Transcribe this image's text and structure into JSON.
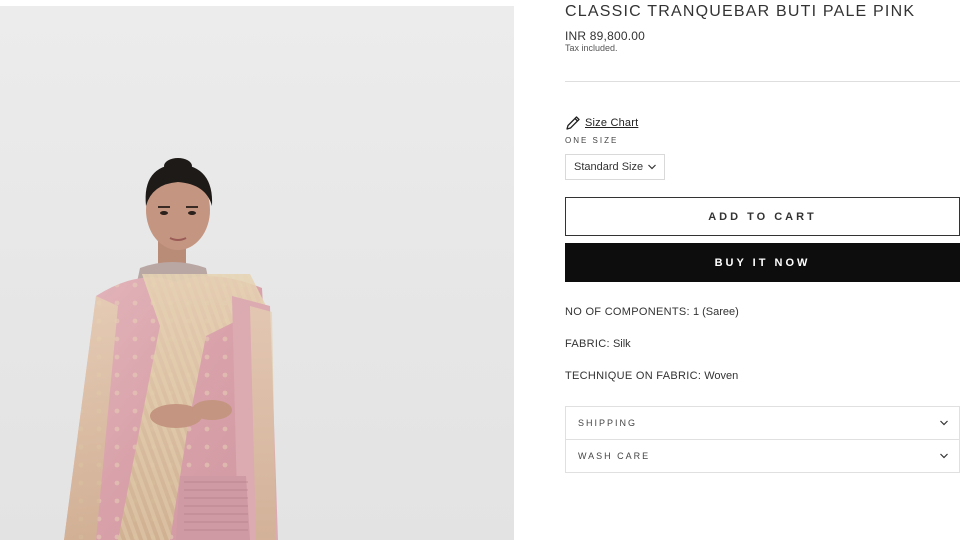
{
  "product": {
    "title": "CLASSIC TRANQUEBAR BUTI PALE PINK",
    "price": "INR 89,800.00",
    "tax_note": "Tax included.",
    "image_alt": "Model wearing pale pink silk saree"
  },
  "size": {
    "chart_link": "Size Chart",
    "label": "ONE SIZE",
    "selected": "Standard Size"
  },
  "actions": {
    "add_to_cart": "ADD TO CART",
    "buy_now": "BUY IT NOW"
  },
  "specs": [
    {
      "key": "NO OF COMPONENTS:",
      "value": "1 (Saree)"
    },
    {
      "key": "FABRIC:",
      "value": "Silk"
    },
    {
      "key": "TECHNIQUE ON FABRIC:",
      "value": "Woven"
    }
  ],
  "accordion": [
    {
      "label": "SHIPPING",
      "icon": "chevron-down-icon"
    },
    {
      "label": "WASH CARE",
      "icon": "chevron-down-icon"
    }
  ],
  "colors": {
    "saree": "#d9a7ae",
    "border_gold": "#d9c3a0",
    "button_dark": "#0d0d0d",
    "background": "#e9e9e9"
  }
}
